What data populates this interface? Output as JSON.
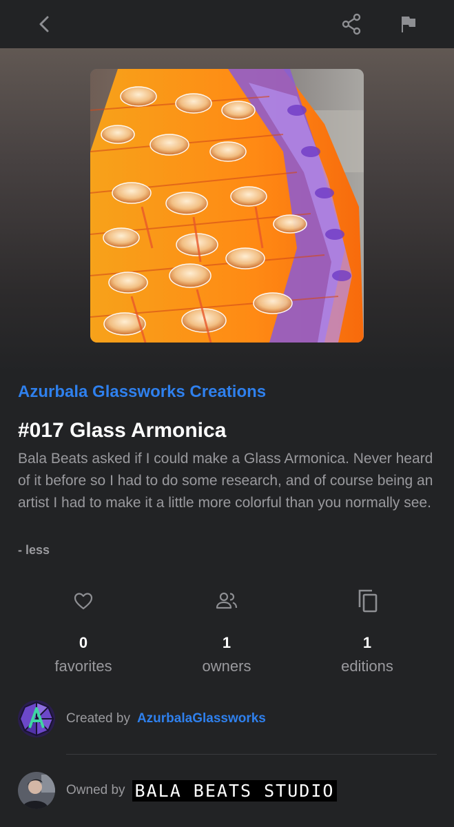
{
  "header": {
    "back_icon": "chevron-left-icon",
    "share_icon": "share-icon",
    "report_icon": "flag-icon"
  },
  "nft": {
    "collection": "Azurbala Glassworks Creations",
    "title": "#017 Glass Armonica",
    "description": "Bala Beats asked if I could make a Glass Armonica. Never heard of it before so I had to do some research, and of course being an artist I had to make it a little more colorful than you normally see.",
    "toggle_label": "- less"
  },
  "stats": [
    {
      "icon": "heart-icon",
      "value": "0",
      "label": "favorites"
    },
    {
      "icon": "owners-icon",
      "value": "1",
      "label": "owners"
    },
    {
      "icon": "copies-icon",
      "value": "1",
      "label": "editions"
    }
  ],
  "creator": {
    "prefix": "Created by",
    "name": "AzurbalaGlassworks"
  },
  "owner": {
    "prefix": "Owned by",
    "name": "BALA BEATS STUDIO"
  },
  "colors": {
    "accent": "#2f80ed",
    "background": "#222325",
    "muted": "#9a9a9e"
  }
}
